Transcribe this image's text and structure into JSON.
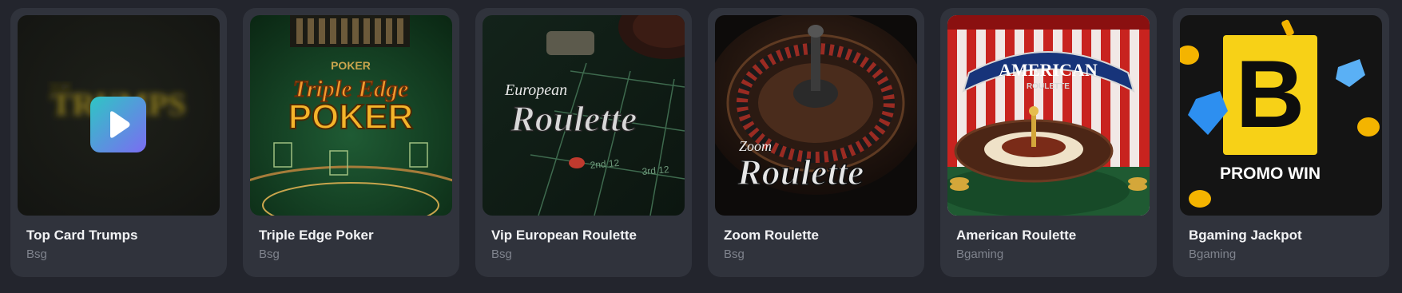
{
  "games": [
    {
      "title": "Top Card Trumps",
      "provider": "Bsg",
      "thumb_text": "TRUMPS",
      "play_icon": "play-icon"
    },
    {
      "title": "Triple Edge Poker",
      "provider": "Bsg",
      "thumb_text_top": "POKER",
      "thumb_text_mid": "Triple Edge",
      "thumb_text_big": "POKER"
    },
    {
      "title": "Vip European Roulette",
      "provider": "Bsg",
      "thumb_text_small": "European",
      "thumb_text_big": "Roulette",
      "table_labels": [
        "2nd 12",
        "3rd 12"
      ]
    },
    {
      "title": "Zoom Roulette",
      "provider": "Bsg",
      "thumb_text_small": "Zoom",
      "thumb_text_big": "Roulette"
    },
    {
      "title": "American Roulette",
      "provider": "Bgaming",
      "thumb_text_top": "AMERICAN",
      "thumb_text_sub": "ROULETTE"
    },
    {
      "title": "Bgaming Jackpot",
      "provider": "Bgaming",
      "thumb_logo": "B",
      "thumb_text": "PROMO WIN"
    }
  ],
  "colors": {
    "page_bg": "#23252d",
    "card_bg": "#30333c",
    "title": "#f2f3f5",
    "provider": "#7f838d",
    "play_gradient": [
      "#2ec6c4",
      "#7b6cf2"
    ],
    "promo_yellow": "#f7d117"
  }
}
